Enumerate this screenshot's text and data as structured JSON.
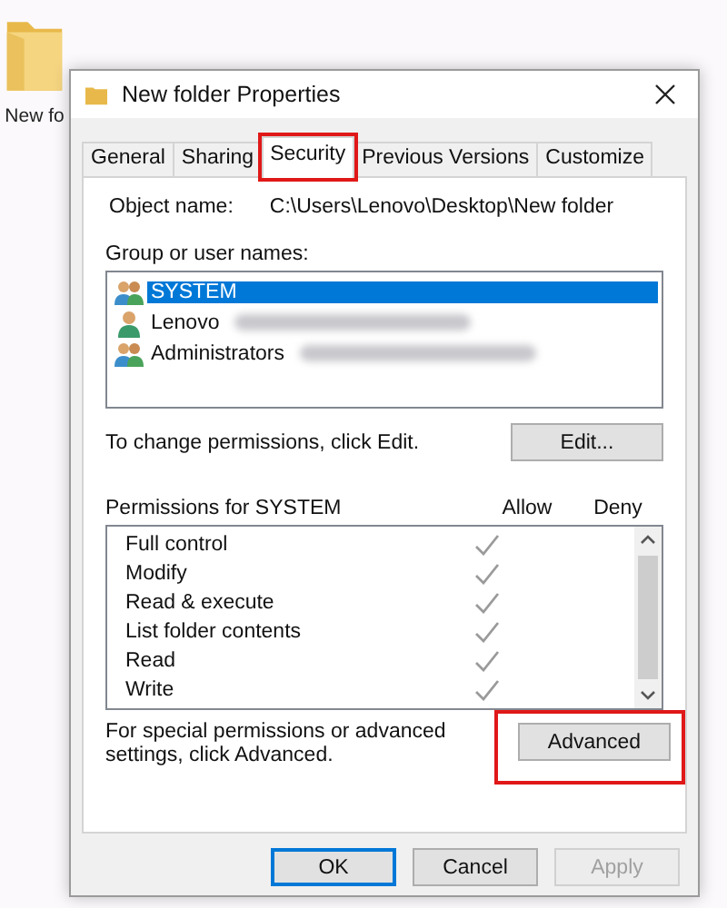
{
  "desktop_icon": {
    "label": "New fo"
  },
  "window": {
    "title": "New folder Properties"
  },
  "tabs": [
    {
      "label": "General",
      "selected": false,
      "highlighted": false
    },
    {
      "label": "Sharing",
      "selected": false,
      "highlighted": false
    },
    {
      "label": "Security",
      "selected": true,
      "highlighted": true
    },
    {
      "label": "Previous Versions",
      "selected": false,
      "highlighted": false
    },
    {
      "label": "Customize",
      "selected": false,
      "highlighted": false
    }
  ],
  "object_name": {
    "label": "Object name:",
    "value": "C:\\Users\\Lenovo\\Desktop\\New folder"
  },
  "groups": {
    "label": "Group or user names:",
    "items": [
      {
        "name": "SYSTEM",
        "kind": "group",
        "selected": true,
        "redacted": false
      },
      {
        "name": "Lenovo",
        "kind": "user",
        "selected": false,
        "redacted": true
      },
      {
        "name": "Administrators",
        "kind": "group",
        "selected": false,
        "redacted": true
      }
    ]
  },
  "change_hint": "To change permissions, click Edit.",
  "edit_button": {
    "label": "Edit..."
  },
  "permissions": {
    "label": "Permissions for SYSTEM",
    "allow_header": "Allow",
    "deny_header": "Deny",
    "rows": [
      {
        "name": "Full control",
        "allow": true,
        "deny": false
      },
      {
        "name": "Modify",
        "allow": true,
        "deny": false
      },
      {
        "name": "Read & execute",
        "allow": true,
        "deny": false
      },
      {
        "name": "List folder contents",
        "allow": true,
        "deny": false
      },
      {
        "name": "Read",
        "allow": true,
        "deny": false
      },
      {
        "name": "Write",
        "allow": true,
        "deny": false
      }
    ]
  },
  "advanced_hint": "For special permissions or advanced settings, click Advanced.",
  "advanced_button": {
    "label": "Advanced",
    "highlighted": true
  },
  "buttons": [
    {
      "label": "OK",
      "kind": "default"
    },
    {
      "label": "Cancel",
      "kind": "normal"
    },
    {
      "label": "Apply",
      "kind": "disabled"
    }
  ]
}
